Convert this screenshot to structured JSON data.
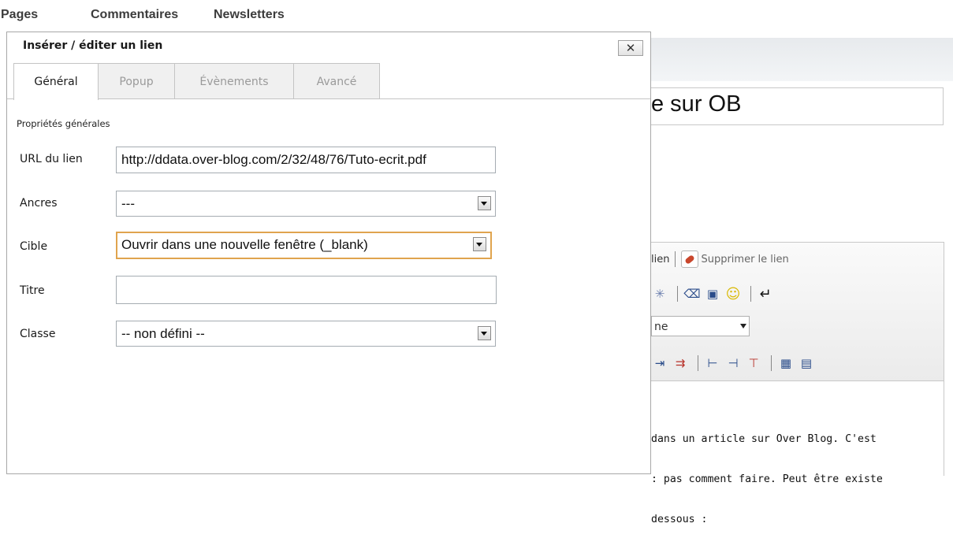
{
  "nav": {
    "items": [
      "Pages",
      "Commentaires",
      "Newsletters"
    ]
  },
  "background": {
    "title_fragment": "e sur OB",
    "toolbar": {
      "link_fragment": "lien",
      "unlink_label": "Supprimer le lien",
      "format_select_fragment": "ne"
    },
    "content_lines": [
      "dans un article sur Over Blog. C'est",
      ": pas comment faire. Peut être existe",
      "dessous :"
    ]
  },
  "dialog": {
    "title": "Insérer / éditer un lien",
    "close_label": "✕",
    "tabs": [
      {
        "label": "Général",
        "active": true
      },
      {
        "label": "Popup",
        "active": false
      },
      {
        "label": "Évènements",
        "active": false
      },
      {
        "label": "Avancé",
        "active": false
      }
    ],
    "section_title": "Propriétés générales",
    "fields": {
      "url": {
        "label": "URL du lien",
        "value": "http://ddata.over-blog.com/2/32/48/76/Tuto-ecrit.pdf"
      },
      "anchors": {
        "label": "Ancres",
        "value": "---"
      },
      "target": {
        "label": "Cible",
        "value": "Ouvrir dans une nouvelle fenêtre (_blank)"
      },
      "title": {
        "label": "Titre",
        "value": ""
      },
      "class": {
        "label": "Classe",
        "value": "-- non défini --"
      }
    }
  },
  "colors": {
    "focus_border": "#e0a44e",
    "tab_inactive_text": "#9a9a9a",
    "unlink_icon": "#c9462c"
  }
}
